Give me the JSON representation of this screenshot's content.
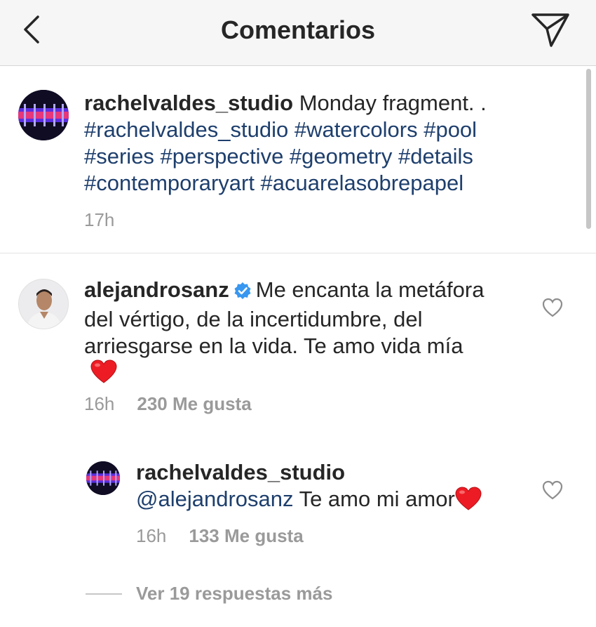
{
  "header": {
    "title": "Comentarios",
    "back_icon": "chevron-left-icon",
    "send_icon": "paper-plane-icon"
  },
  "caption": {
    "username": "rachelvaldes_studio",
    "text": "Monday fragment. .",
    "hashtags_line1": "#rachelvaldes_studio #watercolors #pool",
    "hashtags_line2": "#series #perspective #geometry #details",
    "hashtags_line3": "#contemporaryart #acuarelasobrepapel",
    "time": "17h"
  },
  "comments": [
    {
      "username": "alejandrosanz",
      "verified": true,
      "text_line1": "Me encanta la metáfora",
      "text_line2": "del vértigo, de la incertidumbre, del",
      "text_line3": "arriesgarse en la vida. Te amo vida mía",
      "emoji": "❤️",
      "time": "16h",
      "likes": "230 Me gusta"
    }
  ],
  "reply": {
    "username": "rachelvaldes_studio",
    "mention": "@alejandrosanz",
    "text": "Te amo mi amor",
    "emoji": "❤️",
    "time": "16h",
    "likes": "133 Me gusta"
  },
  "view_more_replies": "Ver 19 respuestas más",
  "colors": {
    "hashtag": "#1e3f6d",
    "meta": "#9a9a9a",
    "verified": "#3897f0",
    "heart": "#ed1c24"
  }
}
